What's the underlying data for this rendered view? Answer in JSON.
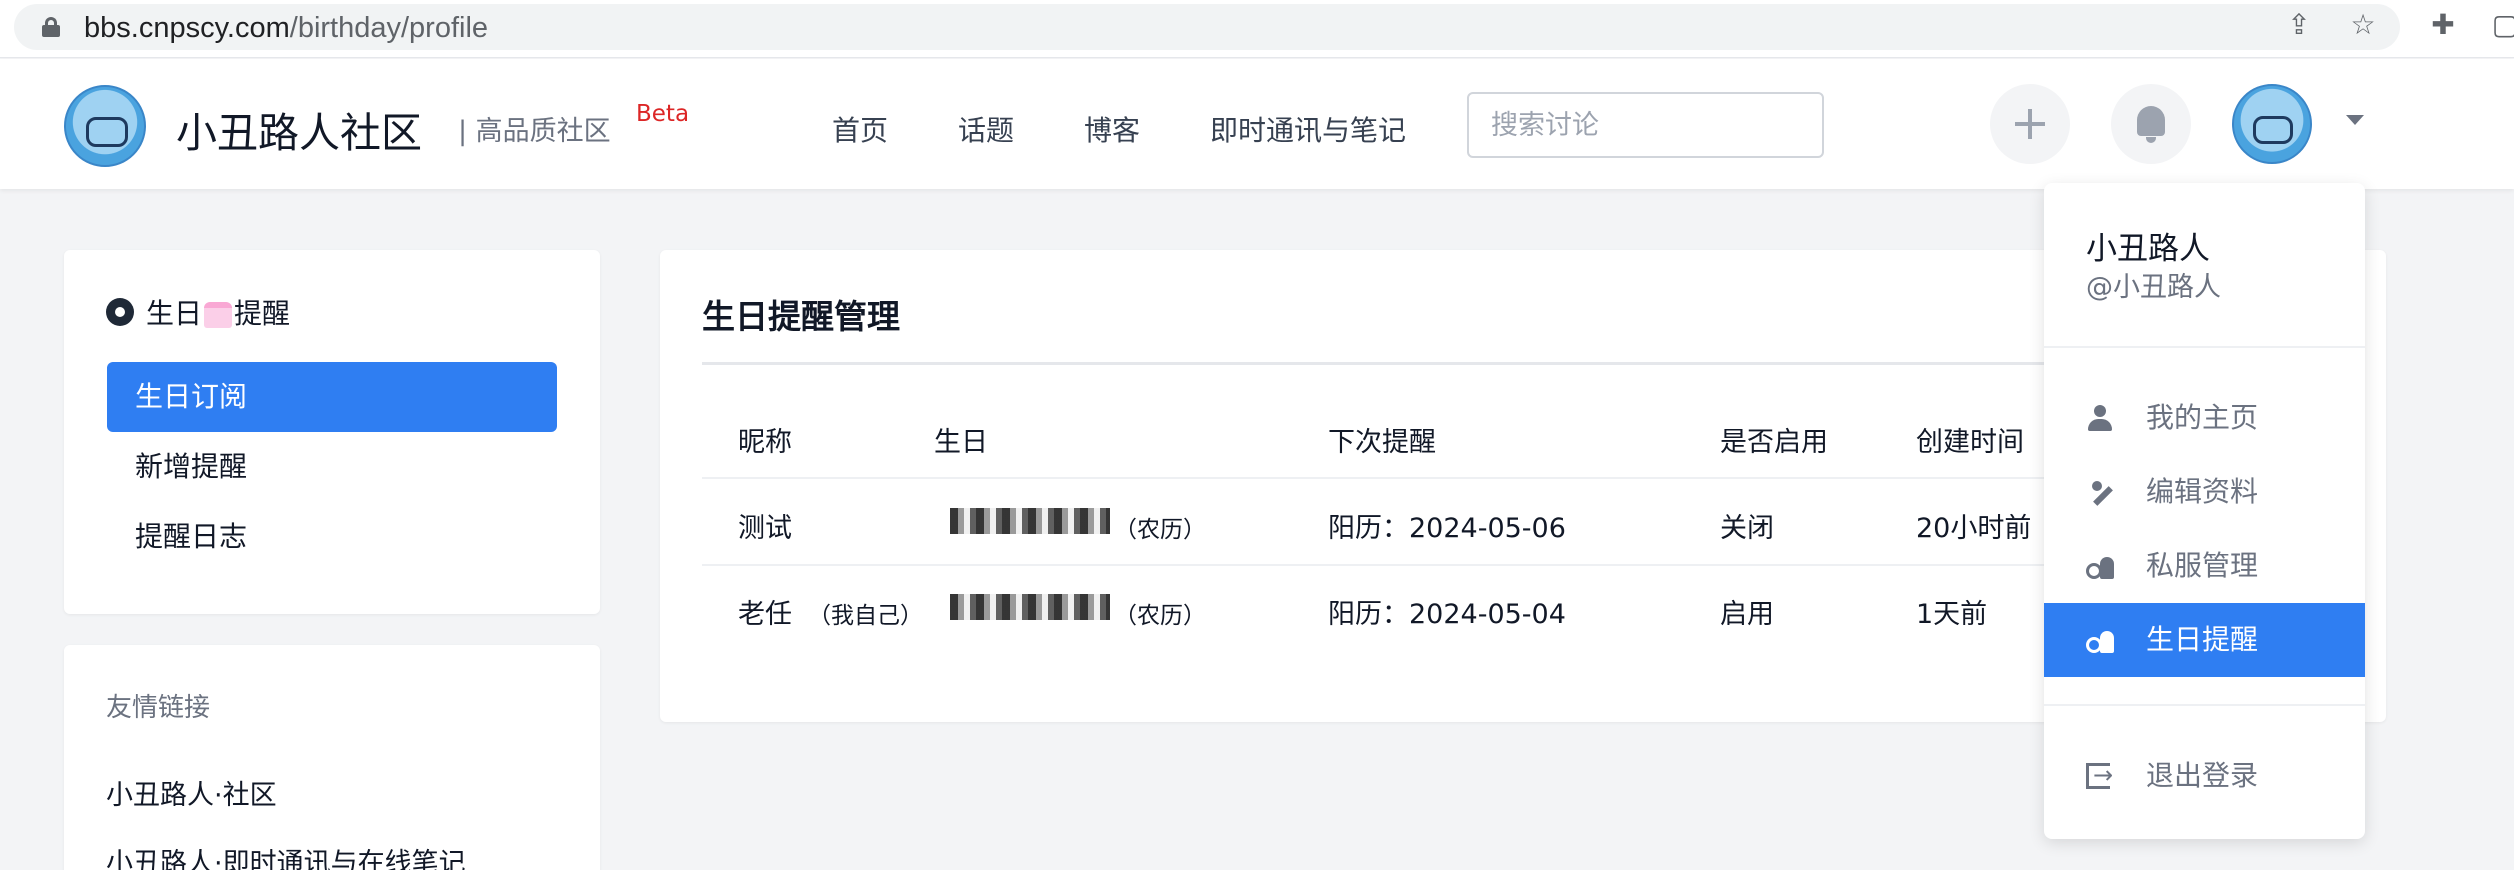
{
  "browser": {
    "url_host": "bbs.cnpscy.com",
    "url_path": "/birthday/profile"
  },
  "header": {
    "site_title": "小丑路人社区",
    "site_subtitle": "| 高品质社区",
    "beta": "Beta",
    "nav": [
      "首页",
      "话题",
      "博客",
      "即时通讯与笔记"
    ],
    "search_placeholder": "搜索讨论"
  },
  "sidebar": {
    "title_prefix": "生日",
    "title_suffix": "提醒",
    "items": [
      {
        "label": "生日订阅",
        "active": true
      },
      {
        "label": "新增提醒",
        "active": false
      },
      {
        "label": "提醒日志",
        "active": false
      }
    ]
  },
  "links": {
    "title": "友情链接",
    "items": [
      "小丑路人·社区",
      "小丑路人·即时通讯与在线笔记"
    ]
  },
  "main": {
    "title": "生日提醒管理",
    "columns": [
      "昵称",
      "生日",
      "下次提醒",
      "是否启用",
      "创建时间"
    ],
    "rows": [
      {
        "name": "测试",
        "name_note": "",
        "birthday_note": "（农历）",
        "next": "阳历：2024-05-06",
        "enabled": "关闭",
        "created": "20小时前"
      },
      {
        "name": "老任",
        "name_note": "（我自己）",
        "birthday_note": "（农历）",
        "next": "阳历：2024-05-04",
        "enabled": "启用",
        "created": "1天前"
      }
    ]
  },
  "dropdown": {
    "name": "小丑路人",
    "handle": "@小丑路人",
    "items": [
      {
        "label": "我的主页",
        "icon": "user-icon"
      },
      {
        "label": "编辑资料",
        "icon": "edit-icon"
      },
      {
        "label": "私服管理",
        "icon": "key-icon"
      },
      {
        "label": "生日提醒",
        "icon": "key-icon",
        "active": true
      }
    ],
    "logout": "退出登录"
  },
  "colors": {
    "primary": "#2f7ef2",
    "beta": "#dc2626"
  }
}
